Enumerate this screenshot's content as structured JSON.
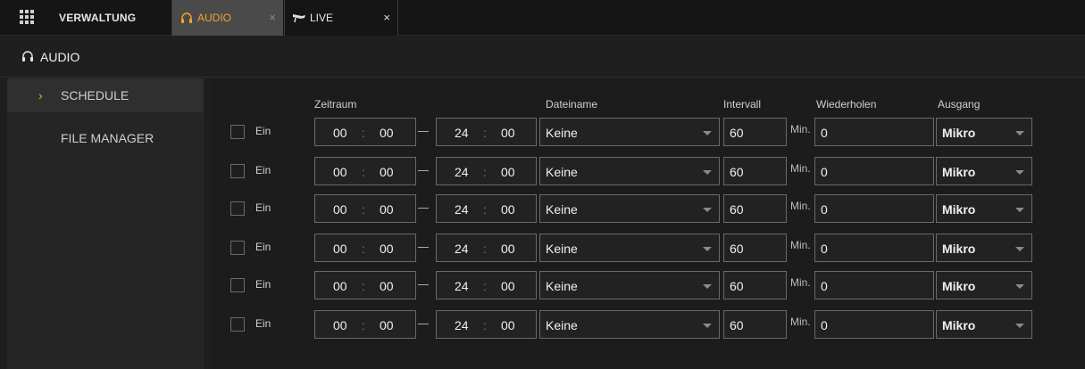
{
  "topbar": {
    "brand": "VERWALTUNG",
    "tabs": [
      {
        "label": "AUDIO",
        "icon": "headphones-icon",
        "close": "×"
      },
      {
        "label": "LIVE",
        "icon": "camera-icon",
        "close": "×"
      }
    ]
  },
  "section": {
    "title": "AUDIO",
    "icon": "headphones-icon"
  },
  "sidebar": {
    "items": [
      {
        "label": "SCHEDULE",
        "active": true
      },
      {
        "label": "FILE MANAGER",
        "active": false
      }
    ]
  },
  "columns": {
    "zeitraum": "Zeitraum",
    "dateiname": "Dateiname",
    "intervall": "Intervall",
    "wiederholen": "Wiederholen",
    "ausgang": "Ausgang"
  },
  "rows": [
    {
      "enabled_label": "Ein",
      "start_h": "00",
      "start_m": "00",
      "end_h": "24",
      "end_m": "00",
      "file": "Keine",
      "interval": "60",
      "unit": "Min.",
      "repeat": "0",
      "output": "Mikro"
    },
    {
      "enabled_label": "Ein",
      "start_h": "00",
      "start_m": "00",
      "end_h": "24",
      "end_m": "00",
      "file": "Keine",
      "interval": "60",
      "unit": "Min.",
      "repeat": "0",
      "output": "Mikro"
    },
    {
      "enabled_label": "Ein",
      "start_h": "00",
      "start_m": "00",
      "end_h": "24",
      "end_m": "00",
      "file": "Keine",
      "interval": "60",
      "unit": "Min.",
      "repeat": "0",
      "output": "Mikro"
    },
    {
      "enabled_label": "Ein",
      "start_h": "00",
      "start_m": "00",
      "end_h": "24",
      "end_m": "00",
      "file": "Keine",
      "interval": "60",
      "unit": "Min.",
      "repeat": "0",
      "output": "Mikro"
    },
    {
      "enabled_label": "Ein",
      "start_h": "00",
      "start_m": "00",
      "end_h": "24",
      "end_m": "00",
      "file": "Keine",
      "interval": "60",
      "unit": "Min.",
      "repeat": "0",
      "output": "Mikro"
    },
    {
      "enabled_label": "Ein",
      "start_h": "00",
      "start_m": "00",
      "end_h": "24",
      "end_m": "00",
      "file": "Keine",
      "interval": "60",
      "unit": "Min.",
      "repeat": "0",
      "output": "Mikro"
    }
  ],
  "time_separator": ":",
  "colors": {
    "accent": "#f2a52a",
    "background": "#1c1c1c",
    "border": "#6a6a6a"
  }
}
